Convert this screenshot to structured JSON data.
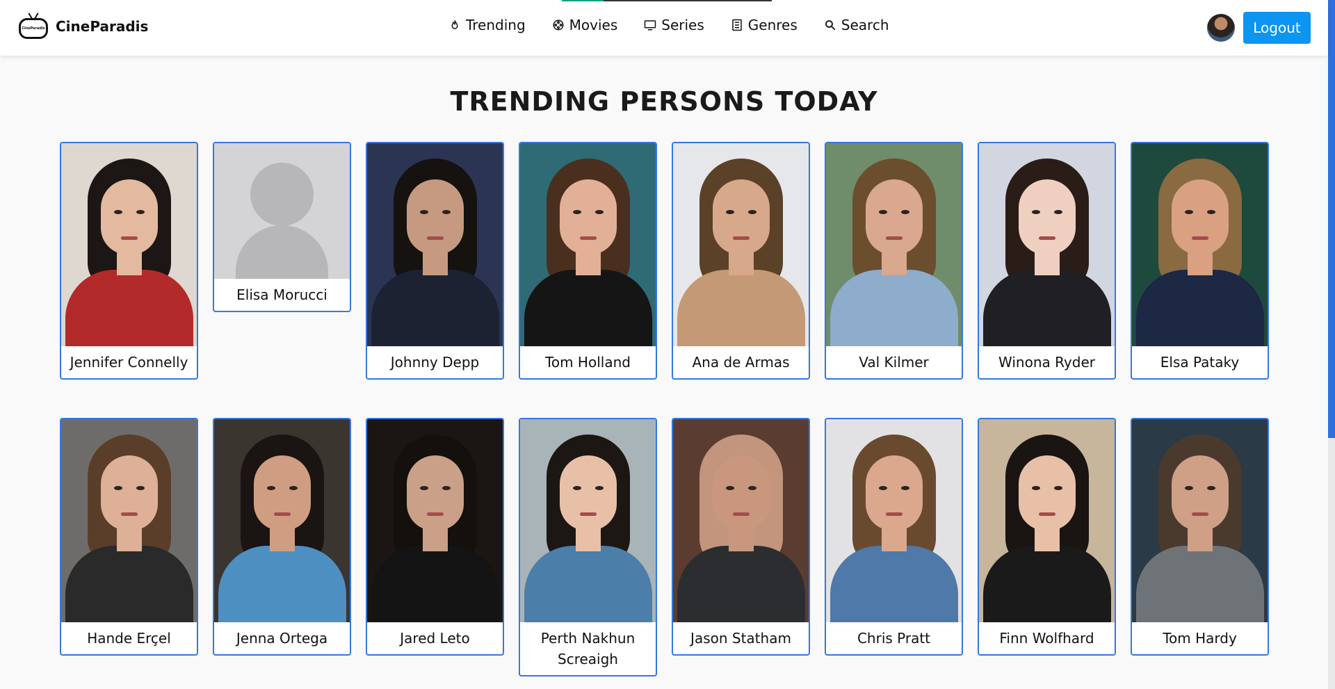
{
  "app": {
    "brand_name": "CineParadis",
    "logo_text": "CineParadis"
  },
  "nav": {
    "items": [
      {
        "label": "Trending",
        "icon": "flame-icon"
      },
      {
        "label": "Movies",
        "icon": "film-reel-icon"
      },
      {
        "label": "Series",
        "icon": "tv-icon"
      },
      {
        "label": "Genres",
        "icon": "list-icon"
      },
      {
        "label": "Search",
        "icon": "search-icon"
      }
    ]
  },
  "user": {
    "logout_label": "Logout"
  },
  "page": {
    "title": "TRENDING PERSONS TODAY"
  },
  "persons": [
    {
      "name": "Jennifer Connelly",
      "has_photo": true,
      "bg": "#ded8d0",
      "hair": "#1c1614",
      "skin": "#e3b9a0",
      "shirt": "#b32a2a"
    },
    {
      "name": "Elisa Morucci",
      "has_photo": false
    },
    {
      "name": "Johnny Depp",
      "has_photo": true,
      "bg": "#2b3553",
      "hair": "#151210",
      "skin": "#c69a80",
      "shirt": "#1d2233"
    },
    {
      "name": "Tom Holland",
      "has_photo": true,
      "bg": "#2f6b74",
      "hair": "#4a2f1e",
      "skin": "#e2b097",
      "shirt": "#151515"
    },
    {
      "name": "Ana de Armas",
      "has_photo": true,
      "bg": "#e6e7ea",
      "hair": "#5b4128",
      "skin": "#d8a88a",
      "shirt": "#c49a76"
    },
    {
      "name": "Val Kilmer",
      "has_photo": true,
      "bg": "#6f8d6a",
      "hair": "#6b4e2e",
      "skin": "#d9a88f",
      "shirt": "#8eaccc"
    },
    {
      "name": "Winona Ryder",
      "has_photo": true,
      "bg": "#d2d6e0",
      "hair": "#2a1d18",
      "skin": "#efd0c0",
      "shirt": "#1f1f24"
    },
    {
      "name": "Elsa Pataky",
      "has_photo": true,
      "bg": "#1d4a3c",
      "hair": "#8a6a40",
      "skin": "#d9a082",
      "shirt": "#1c2844"
    },
    {
      "name": "Hande Erçel",
      "has_photo": true,
      "bg": "#6e6c6a",
      "hair": "#5a3e2a",
      "skin": "#ddb097",
      "shirt": "#2a2a2a"
    },
    {
      "name": "Jenna Ortega",
      "has_photo": true,
      "bg": "#3b3530",
      "hair": "#1a1412",
      "skin": "#cf9e82",
      "shirt": "#4d8fc0"
    },
    {
      "name": "Jared Leto",
      "has_photo": true,
      "bg": "#1b1613",
      "hair": "#14100e",
      "skin": "#caa088",
      "shirt": "#141414"
    },
    {
      "name": "Perth Nakhun Screaigh",
      "has_photo": true,
      "bg": "#a9b4b8",
      "hair": "#1d1714",
      "skin": "#e8c0a8",
      "shirt": "#4b7ea8"
    },
    {
      "name": "Jason Statham",
      "has_photo": true,
      "bg": "#5a3d30",
      "hair": "#c2957c",
      "skin": "#c9977e",
      "shirt": "#2c2d30"
    },
    {
      "name": "Chris Pratt",
      "has_photo": true,
      "bg": "#e2e2e4",
      "hair": "#6a4a2e",
      "skin": "#dba88e",
      "shirt": "#4f79a8"
    },
    {
      "name": "Finn Wolfhard",
      "has_photo": true,
      "bg": "#c7b59c",
      "hair": "#1a1412",
      "skin": "#e8c0a8",
      "shirt": "#1a1a1a"
    },
    {
      "name": "Tom Hardy",
      "has_photo": true,
      "bg": "#2a3a46",
      "hair": "#4a3a2e",
      "skin": "#cf9f86",
      "shirt": "#6e7378"
    }
  ],
  "colors": {
    "accent": "#0c95f3",
    "card_border": "#3577e0",
    "page_bg": "#f9f9f9"
  }
}
